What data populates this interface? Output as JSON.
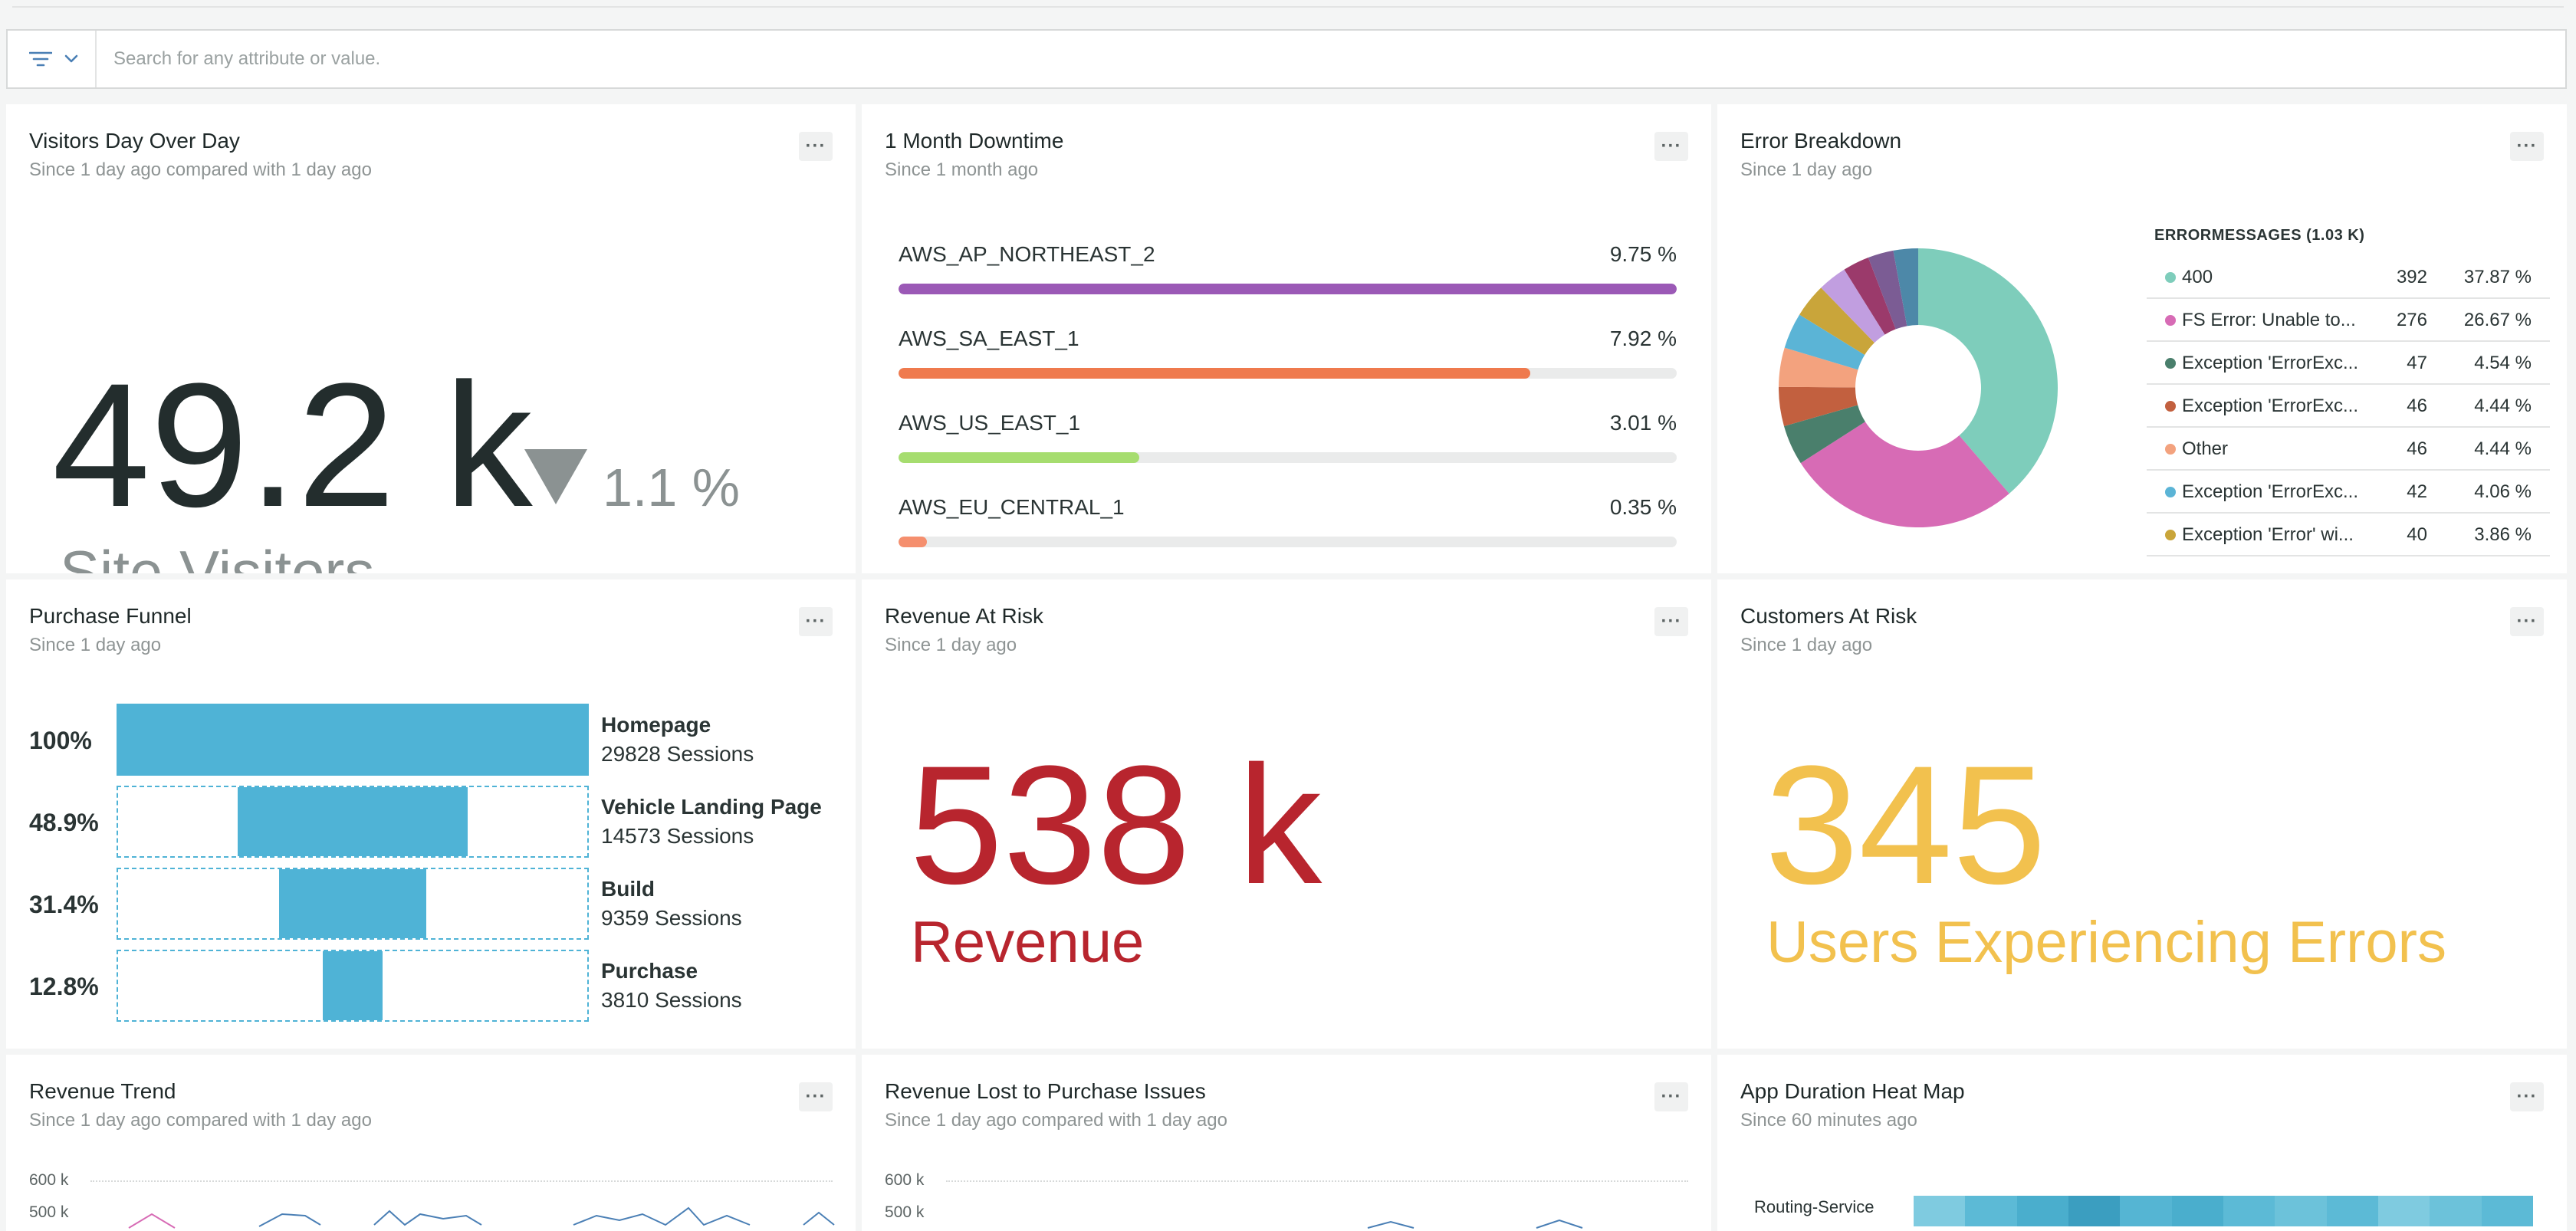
{
  "search": {
    "placeholder": "Search for any attribute or value."
  },
  "icons": {
    "filter": "filter-lines-icon",
    "chevron": "chevron-down-icon",
    "more": "ellipsis-icon"
  },
  "colors": {
    "accent": "#4fb3d6",
    "revenue": "#b8252e",
    "customers": "#f2c14e",
    "muted": "#8b9292"
  },
  "cards": {
    "visitors": {
      "title": "Visitors Day Over Day",
      "subtitle": "Since 1 day ago compared with 1 day ago",
      "value": "49.2 k",
      "delta": "1.1 %",
      "delta_direction": "down",
      "label": "Site Visitors"
    },
    "downtime": {
      "title": "1 Month Downtime",
      "subtitle": "Since 1 month ago",
      "rows": [
        {
          "name": "AWS_AP_NORTHEAST_2",
          "pct": "9.75 %",
          "fill": 1.0,
          "color": "#9b59b6"
        },
        {
          "name": "AWS_SA_EAST_1",
          "pct": "7.92 %",
          "fill": 0.812,
          "color": "#ef7a4e"
        },
        {
          "name": "AWS_US_EAST_1",
          "pct": "3.01 %",
          "fill": 0.309,
          "color": "#a6dd6f"
        },
        {
          "name": "AWS_EU_CENTRAL_1",
          "pct": "0.35 %",
          "fill": 0.036,
          "color": "#f58f6e"
        }
      ]
    },
    "errors": {
      "title": "Error Breakdown",
      "subtitle": "Since 1 day ago",
      "legend_title": "ERRORMESSAGES (1.03 K)",
      "rows": [
        {
          "name": "400",
          "count": "392",
          "pct": "37.87 %",
          "color": "#7ecdbb"
        },
        {
          "name": "FS Error: Unable to...",
          "count": "276",
          "pct": "26.67 %",
          "color": "#d76bb5"
        },
        {
          "name": "Exception 'ErrorExc...",
          "count": "47",
          "pct": "4.54 %",
          "color": "#4a7f6c"
        },
        {
          "name": "Exception 'ErrorExc...",
          "count": "46",
          "pct": "4.44 %",
          "color": "#c2603f"
        },
        {
          "name": "Other",
          "count": "46",
          "pct": "4.44 %",
          "color": "#f3a27e"
        },
        {
          "name": "Exception 'ErrorExc...",
          "count": "42",
          "pct": "4.06 %",
          "color": "#5bb4d6"
        },
        {
          "name": "Exception 'Error' wi...",
          "count": "40",
          "pct": "3.86 %",
          "color": "#c9a53a"
        }
      ],
      "donut_extra": [
        {
          "value": 3.3,
          "color": "#c19ee0"
        },
        {
          "value": 3.0,
          "color": "#9b3a6b"
        },
        {
          "value": 2.9,
          "color": "#7b5c94"
        },
        {
          "value": 2.8,
          "color": "#4d88a8"
        }
      ]
    },
    "funnel": {
      "title": "Purchase Funnel",
      "subtitle": "Since 1 day ago",
      "steps": [
        {
          "pct": "100%",
          "name": "Homepage",
          "sessions": "29828 Sessions",
          "fraction": 1.0
        },
        {
          "pct": "48.9%",
          "name": "Vehicle Landing Page",
          "sessions": "14573 Sessions",
          "fraction": 0.489
        },
        {
          "pct": "31.4%",
          "name": "Build",
          "sessions": "9359 Sessions",
          "fraction": 0.314
        },
        {
          "pct": "12.8%",
          "name": "Purchase",
          "sessions": "3810 Sessions",
          "fraction": 0.128
        }
      ]
    },
    "revenue_risk": {
      "title": "Revenue At Risk",
      "subtitle": "Since 1 day ago",
      "value": "538 k",
      "label": "Revenue"
    },
    "customers_risk": {
      "title": "Customers At Risk",
      "subtitle": "Since 1 day ago",
      "value": "345",
      "label": "Users Experiencing Errors"
    },
    "revenue_trend": {
      "title": "Revenue Trend",
      "subtitle": "Since 1 day ago compared with 1 day ago",
      "y_ticks": [
        "600 k",
        "500 k"
      ]
    },
    "revenue_lost": {
      "title": "Revenue Lost to Purchase Issues",
      "subtitle": "Since 1 day ago compared with 1 day ago",
      "y_ticks": [
        "600 k",
        "500 k"
      ]
    },
    "heatmap": {
      "title": "App Duration Heat Map",
      "subtitle": "Since 60 minutes ago",
      "row_label": "Routing-Service"
    }
  }
}
